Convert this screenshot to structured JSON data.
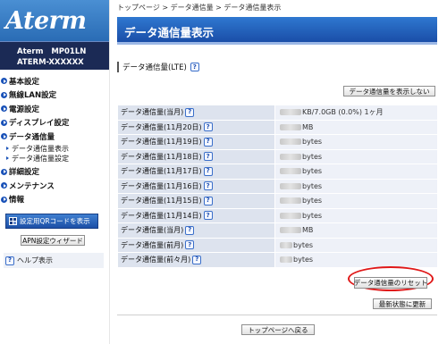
{
  "brand": {
    "logo": "Aterm",
    "model_line1": "Aterm   MP01LN",
    "model_line2": "ATERM-XXXXXX"
  },
  "sidebar": {
    "items": [
      {
        "label": "基本設定"
      },
      {
        "label": "無線LAN設定"
      },
      {
        "label": "電源設定"
      },
      {
        "label": "ディスプレイ設定"
      },
      {
        "label": "データ通信量"
      },
      {
        "label": "詳細設定"
      },
      {
        "label": "メンテナンス"
      },
      {
        "label": "情報"
      }
    ],
    "sub_items": [
      {
        "label": "データ通信量表示"
      },
      {
        "label": "データ通信量設定"
      }
    ],
    "qr_button": "設定用QRコードを表示",
    "apn_button": "APN設定ウィザード",
    "help_label": "ヘルプ表示"
  },
  "main": {
    "breadcrumb": "トップページ > データ通信量 > データ通信量表示",
    "page_title": "データ通信量表示",
    "section_title": "データ通信量(LTE)",
    "hide_button": "データ通信量を表示しない",
    "rows": [
      {
        "label": "データ通信量(当月)",
        "value": "KB/7.0GB (0.0%)  1ヶ月"
      },
      {
        "label": "データ通信量(11月20日)",
        "value": "MB"
      },
      {
        "label": "データ通信量(11月19日)",
        "value": "bytes"
      },
      {
        "label": "データ通信量(11月18日)",
        "value": "bytes"
      },
      {
        "label": "データ通信量(11月17日)",
        "value": "bytes"
      },
      {
        "label": "データ通信量(11月16日)",
        "value": "bytes"
      },
      {
        "label": "データ通信量(11月15日)",
        "value": "bytes"
      },
      {
        "label": "データ通信量(11月14日)",
        "value": "bytes"
      },
      {
        "label": "データ通信量(当月)",
        "value": "MB"
      },
      {
        "label": "データ通信量(前月)",
        "value": "bytes"
      },
      {
        "label": "データ通信量(前々月)",
        "value": "bytes"
      }
    ],
    "reset_button": "データ通信量のリセット",
    "refresh_button": "最新状態に更新",
    "top_button": "トップページへ戻る"
  },
  "help_glyph": "?",
  "colors": {
    "title_bar": "#1a4ea8",
    "nav_bullet": "#1a52b8",
    "highlight_circle": "#e01818",
    "table_label_bg": "#dde3ee",
    "table_value_bg": "#eef1f8"
  }
}
